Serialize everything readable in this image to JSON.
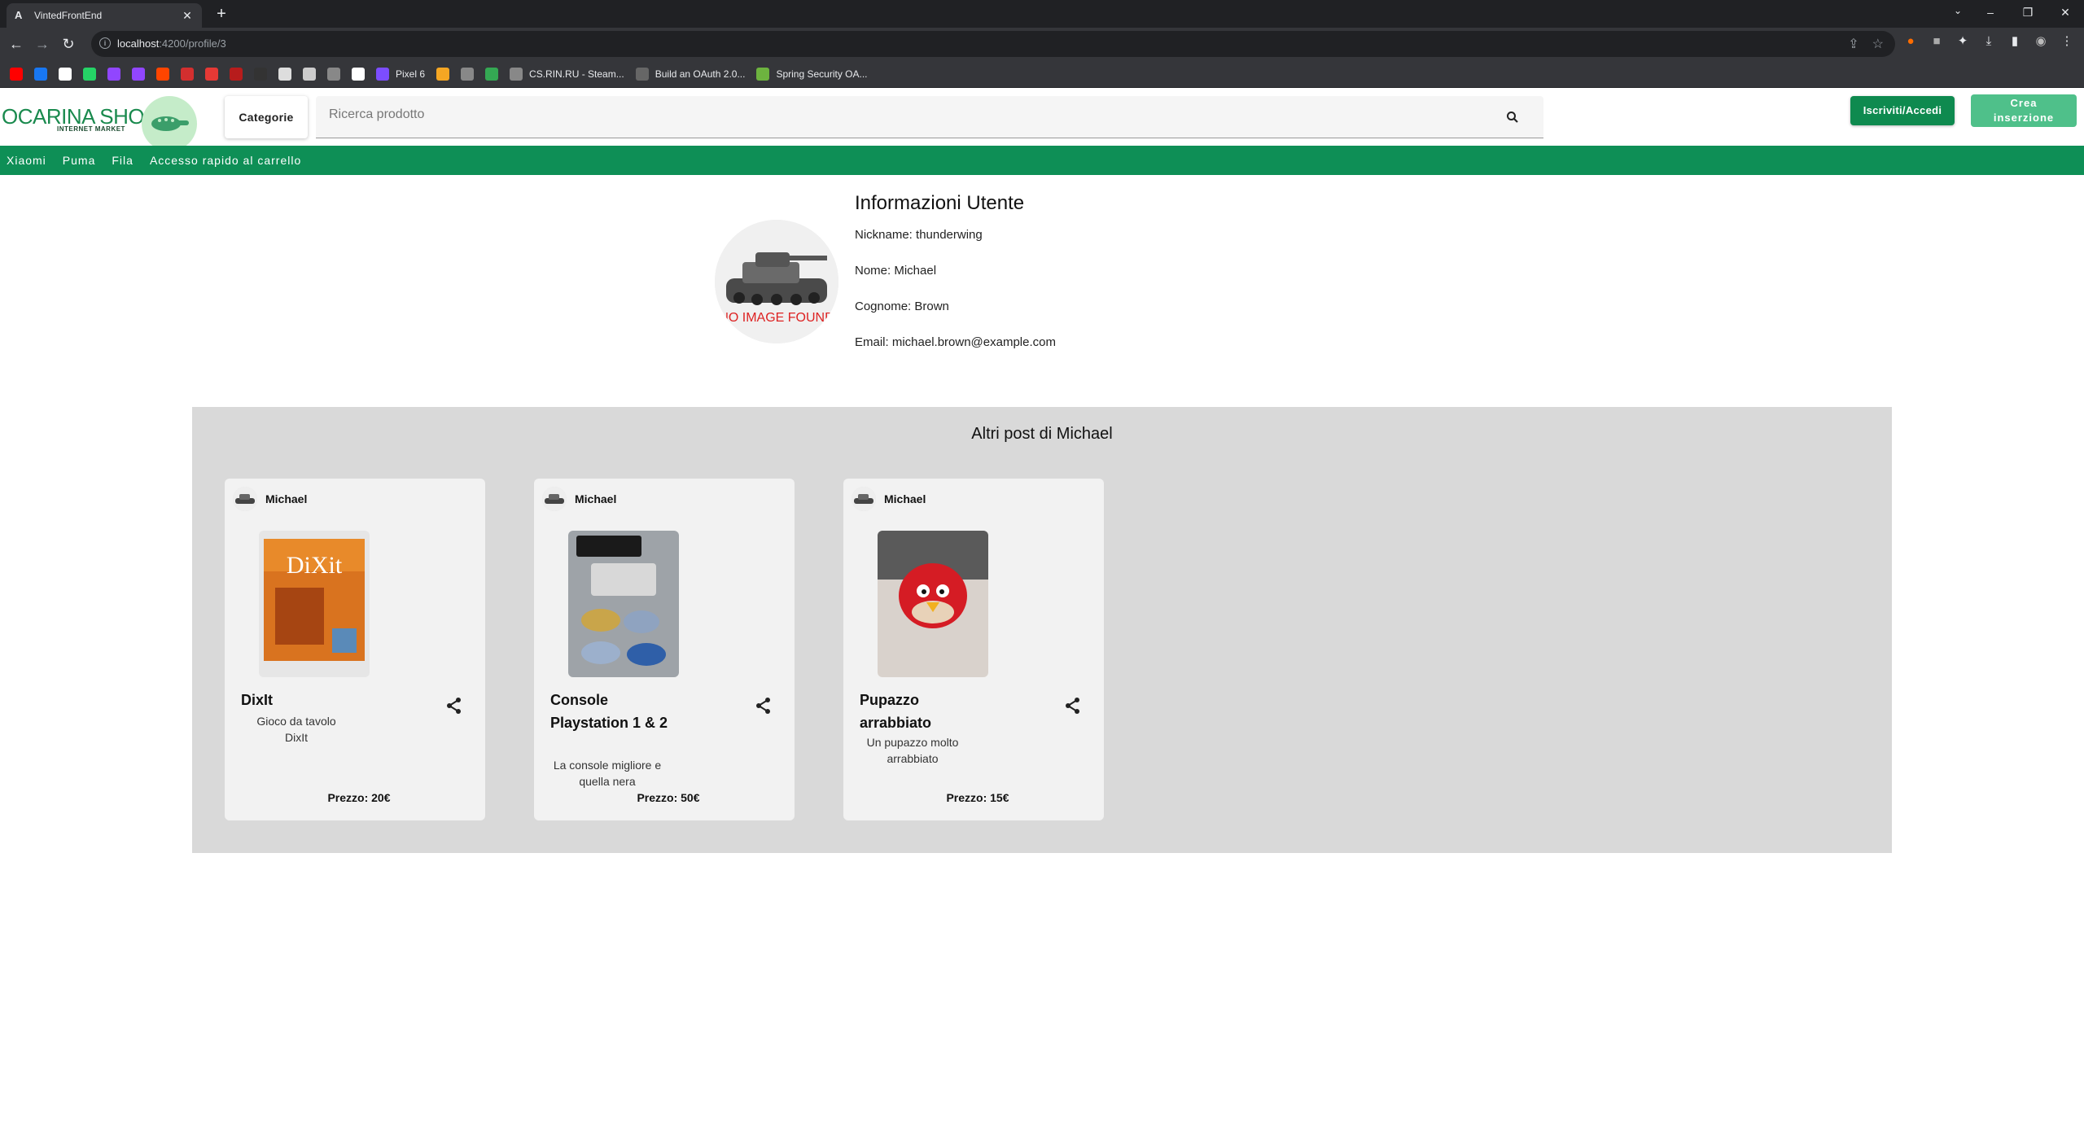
{
  "browser": {
    "tab_title": "VintedFrontEnd",
    "url_host": "localhost",
    "url_rest": ":4200/profile/3",
    "bookmarks": [
      {
        "label": "",
        "color": "#ff0000"
      },
      {
        "label": "",
        "color": "#1877f2"
      },
      {
        "label": "",
        "color": "#ffffff"
      },
      {
        "label": "",
        "color": "#25d366"
      },
      {
        "label": "",
        "color": "#9146ff"
      },
      {
        "label": "",
        "color": "#9146ff"
      },
      {
        "label": "",
        "color": "#ff4500"
      },
      {
        "label": "",
        "color": "#d32f2f"
      },
      {
        "label": "",
        "color": "#e53935"
      },
      {
        "label": "",
        "color": "#b71c1c"
      },
      {
        "label": "",
        "color": "#333333"
      },
      {
        "label": "",
        "color": "#dddddd"
      },
      {
        "label": "",
        "color": "#cccccc"
      },
      {
        "label": "",
        "color": "#888888"
      },
      {
        "label": "",
        "color": "#ffffff"
      },
      {
        "label": "Pixel 6",
        "color": "#7c4dff"
      },
      {
        "label": "",
        "color": "#f5a623"
      },
      {
        "label": "",
        "color": "#888888"
      },
      {
        "label": "",
        "color": "#34a853"
      },
      {
        "label": "CS.RIN.RU - Steam...",
        "color": "#888888"
      },
      {
        "label": "Build an OAuth 2.0...",
        "color": "#666666"
      },
      {
        "label": "Spring Security OA...",
        "color": "#6db33f"
      }
    ]
  },
  "header": {
    "logo_title": "OCARINA SHOP",
    "logo_subtitle": "INTERNET MARKET",
    "categories_label": "Categorie",
    "search_placeholder": "Ricerca prodotto",
    "login_label": "Iscriviti/Accedi",
    "create_label_line1": "Crea",
    "create_label_line2": "inserzione"
  },
  "nav": {
    "items": [
      "Xiaomi",
      "Puma",
      "Fila",
      "Accesso rapido al carrello"
    ]
  },
  "profile": {
    "title": "Informazioni Utente",
    "no_image_text": "NO IMAGE FOUND",
    "nickname": "Nickname: thunderwing",
    "nome": "Nome: Michael",
    "cognome": "Cognome: Brown",
    "email": "Email: michael.brown@example.com"
  },
  "posts": {
    "title": "Altri post di Michael",
    "cards": [
      {
        "author": "Michael",
        "title": "DixIt",
        "description": "Gioco da tavolo DixIt",
        "price": "Prezzo: 20€"
      },
      {
        "author": "Michael",
        "title": "Console Playstation 1 & 2",
        "description": "La console migliore e quella nera",
        "price": "Prezzo: 50€"
      },
      {
        "author": "Michael",
        "title": "Pupazzo arrabbiato",
        "description": "Un pupazzo molto arrabbiato",
        "price": "Prezzo: 15€"
      }
    ]
  },
  "colors": {
    "brand_green": "#0e8f56",
    "button_green": "#0e8a4f",
    "button_light_green": "#4fc08a",
    "section_gray": "#d9d9d9"
  }
}
